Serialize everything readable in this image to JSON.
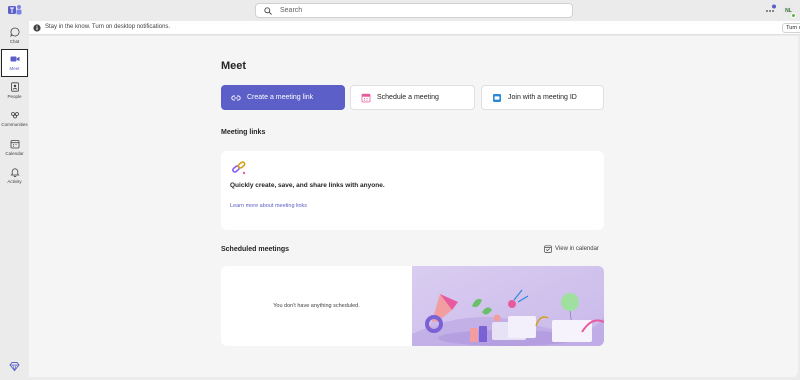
{
  "search": {
    "label": "Search"
  },
  "user": {
    "initials": "NL"
  },
  "notification": {
    "message": "Stay in the know. Turn on desktop notifications.",
    "turn_on_label": "Turn on"
  },
  "rail": {
    "items": [
      {
        "label": "Chat"
      },
      {
        "label": "Meet"
      },
      {
        "label": "People"
      },
      {
        "label": "Communities"
      },
      {
        "label": "Calendar"
      },
      {
        "label": "Activity"
      }
    ]
  },
  "main": {
    "title": "Meet",
    "actions": {
      "create": "Create a meeting link",
      "schedule": "Schedule a meeting",
      "join": "Join with a meeting ID"
    },
    "meeting_links": {
      "heading": "Meeting links",
      "description": "Quickly create, save, and share links with anyone.",
      "learn_more": "Learn more about meeting links"
    },
    "scheduled": {
      "heading": "Scheduled meetings",
      "view_calendar": "View in calendar",
      "empty": "You don't have anything scheduled."
    }
  },
  "colors": {
    "accent": "#5b5fc7",
    "page_bg": "#f5f5f5"
  }
}
